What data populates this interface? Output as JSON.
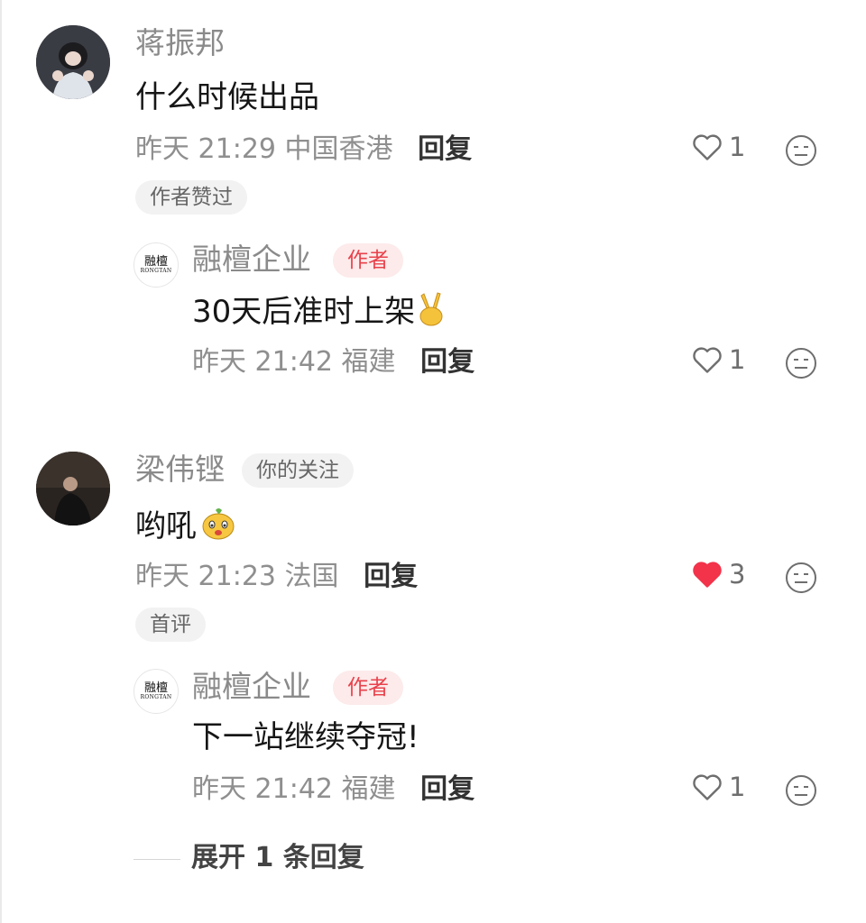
{
  "comments": [
    {
      "username": "蒋振邦",
      "content": "什么时候出品",
      "time": "昨天 21:29",
      "location": "中国香港",
      "reply_label": "回复",
      "likes": "1",
      "liked": false,
      "badge": "作者赞过",
      "reply": {
        "username": "融檀企业",
        "badge": "作者",
        "content": "30天后准时上架",
        "emoji": "✌",
        "time": "昨天 21:42",
        "location": "福建",
        "reply_label": "回复",
        "likes": "1",
        "logo_cn": "融檀",
        "logo_en": "RONGTAN"
      }
    },
    {
      "username": "梁伟铿",
      "user_badge": "你的关注",
      "content": "哟吼",
      "time": "昨天 21:23",
      "location": "法国",
      "reply_label": "回复",
      "likes": "3",
      "liked": true,
      "badge": "首评",
      "reply": {
        "username": "融檀企业",
        "badge": "作者",
        "content": "下一站继续夺冠!",
        "time": "昨天 21:42",
        "location": "福建",
        "reply_label": "回复",
        "likes": "1",
        "logo_cn": "融檀",
        "logo_en": "RONGTAN"
      }
    }
  ],
  "expand_label": "展开 1 条回复",
  "colors": {
    "like_red": "#f2334a",
    "author_red": "#e8424c",
    "meta_gray": "#8f8f8f"
  },
  "icons": [
    "heart-outline-icon",
    "heart-filled-icon",
    "neutral-face-icon",
    "victory-hand-icon",
    "cartoon-face-emoji-icon"
  ]
}
